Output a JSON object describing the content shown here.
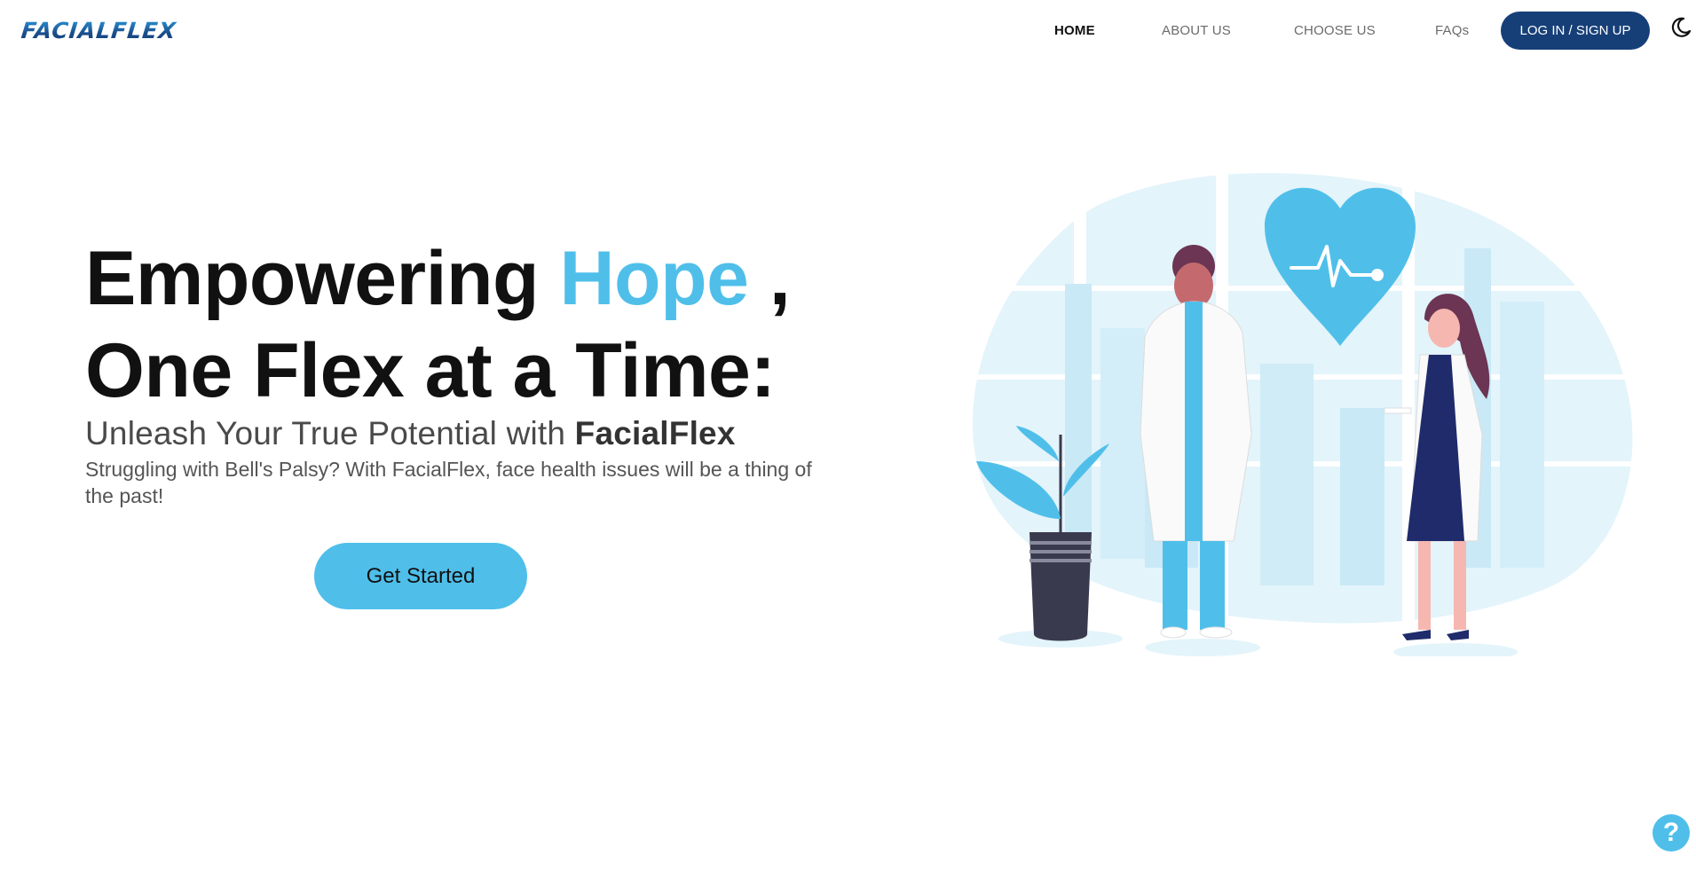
{
  "brand": {
    "logo_text": "FACIALFLEX"
  },
  "nav": {
    "home": "HOME",
    "about": "ABOUT US",
    "choose": "CHOOSE US",
    "faqs": "FAQs",
    "login": "LOG IN / SIGN UP"
  },
  "hero": {
    "headline_part1": "Empowering ",
    "headline_accent": "Hope",
    "headline_comma": " ,",
    "headline_line2": "One Flex at a Time:",
    "subhead_prefix": "Unleash Your True Potential with ",
    "subhead_brand": "FacialFlex",
    "description": "Struggling with Bell's Palsy? With FacialFlex, face health issues will be a thing of the past!",
    "cta_label": "Get Started"
  },
  "help": {
    "label": "?"
  },
  "colors": {
    "accent": "#4fbfea",
    "nav_button": "#163f78",
    "text": "#111111"
  },
  "icons": {
    "theme_toggle": "moon-icon",
    "help": "question-icon"
  }
}
